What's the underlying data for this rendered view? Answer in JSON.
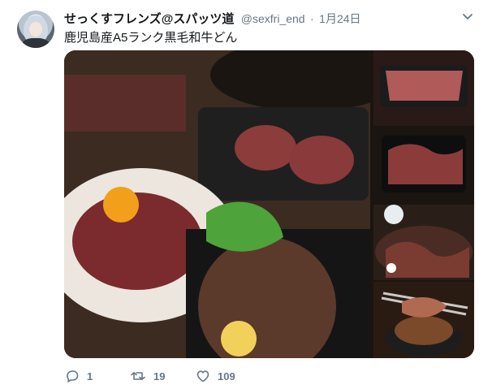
{
  "tweet": {
    "display_name": "せっくすフレンズ@スパッツ道",
    "handle": "@sexfri_end",
    "separator": "·",
    "date": "1月24日",
    "text": "鹿児島産A5ランク黒毛和牛どん"
  },
  "icons": {
    "caret": "chevron-down-icon",
    "reply": "reply-icon",
    "retweet": "retweet-icon",
    "like": "heart-icon"
  },
  "actions": {
    "reply_count": "1",
    "retweet_count": "19",
    "like_count": "109"
  },
  "colors": {
    "text_primary": "#14171a",
    "text_secondary": "#657786"
  }
}
